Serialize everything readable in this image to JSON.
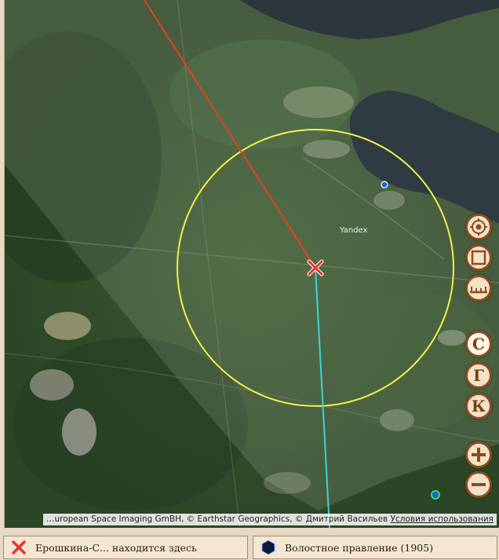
{
  "map": {
    "watermark": "Yandex",
    "attribution_text": "…uropean Space Imaging GmBH, © Earthstar Geographics, © Дмитрий Васильев",
    "attribution_link": "Условия использования",
    "marker_color": "#e8332a",
    "circle_color": "#f2f04a",
    "bearing_line_north_color": "#e8401c",
    "bearing_line_south_color": "#38d6d6"
  },
  "controls": {
    "locate": {
      "icon": "crosshair-target-icon"
    },
    "frame": {
      "icon": "square-frame-icon"
    },
    "ruler": {
      "icon": "ruler-icon"
    },
    "layer_s": {
      "label": "С"
    },
    "layer_g": {
      "label": "Г"
    },
    "layer_k": {
      "label": "К"
    },
    "zoom_in": {
      "icon": "plus-icon"
    },
    "zoom_out": {
      "icon": "minus-icon"
    }
  },
  "legend": {
    "left": {
      "icon": "red-x-icon",
      "text": "Ерошкина-С... находится здесь"
    },
    "right": {
      "icon": "hexagon-icon",
      "text": "Волостное правление (1905)"
    }
  }
}
